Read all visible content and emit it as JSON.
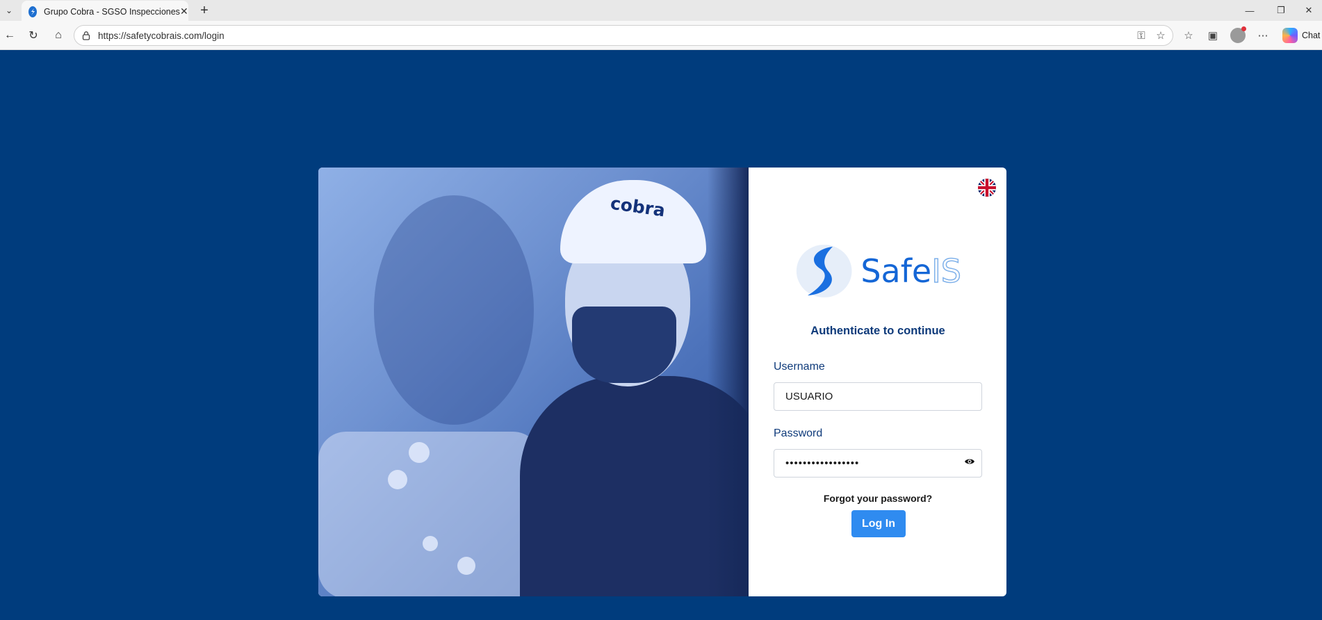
{
  "browser": {
    "tab_title": "Grupo Cobra - SGSO Inspecciones",
    "url": "https://safetycobrais.com/login",
    "chat_label": "Chat"
  },
  "photo": {
    "helmet_brand": "cobra"
  },
  "login": {
    "logo_word_1": "Safe",
    "logo_word_2": "IS",
    "subtitle": "Authenticate to continue",
    "username_label": "Username",
    "username_value": "USUARIO",
    "password_label": "Password",
    "password_value": "•••••••••••••••••",
    "forgot_link": "Forgot your password?",
    "login_button": "Log In",
    "language_flag": "uk-flag-icon"
  },
  "colors": {
    "page_background": "#003c7d",
    "accent": "#2f8bf0",
    "heading": "#0e3a7a"
  }
}
